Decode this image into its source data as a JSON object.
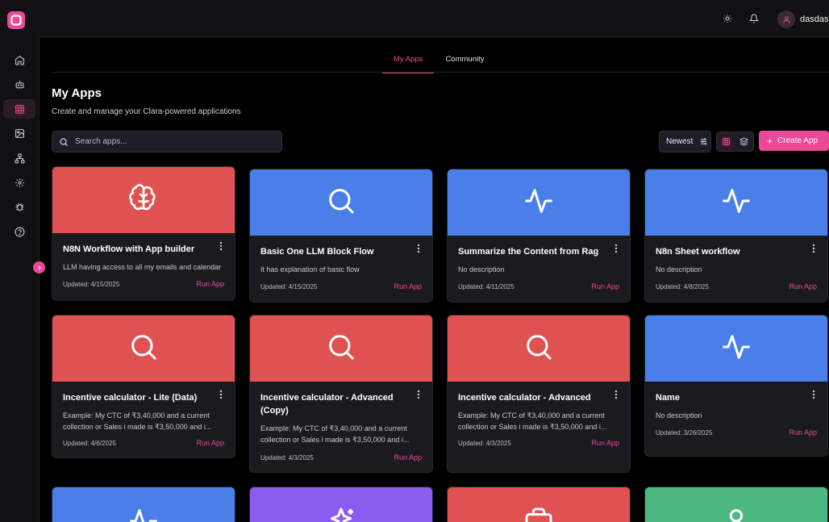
{
  "topbar": {
    "username": "dasdas"
  },
  "tabs": [
    {
      "label": "My Apps",
      "active": true
    },
    {
      "label": "Community",
      "active": false
    }
  ],
  "header": {
    "title": "My Apps",
    "subtitle": "Create and manage your Clara-powered applications"
  },
  "search": {
    "placeholder": "Search apps...",
    "value": ""
  },
  "toolbar": {
    "sort_label": "Newest",
    "create_label": "Create App"
  },
  "colors": {
    "accent": "#ec4899",
    "red": "#e05252",
    "blue": "#4a7ee8",
    "purple": "#8a5cf0",
    "green": "#4cb882"
  },
  "apps": [
    {
      "title": "N8N Workflow with App builder",
      "description": "LLM having access to all my emails and calendar",
      "updated": "Updated: 4/15/2025",
      "run_label": "Run App",
      "icon": "brain-icon",
      "color": "red"
    },
    {
      "title": "Basic One LLM Block Flow",
      "description": "It has explanation of basic flow",
      "updated": "Updated: 4/15/2025",
      "run_label": "Run App",
      "icon": "search-icon",
      "color": "blue"
    },
    {
      "title": "Summarize the Content from Rag",
      "description": "No description",
      "updated": "Updated: 4/11/2025",
      "run_label": "Run App",
      "icon": "activity-icon",
      "color": "blue"
    },
    {
      "title": "N8n Sheet workflow",
      "description": "No description",
      "updated": "Updated: 4/8/2025",
      "run_label": "Run App",
      "icon": "activity-icon",
      "color": "blue"
    },
    {
      "title": "Incentive calculator - Lite (Data)",
      "description": "Example: My CTC of ₹3,40,000 and a current collection or Sales i made is ₹3,50,000 and i...",
      "updated": "Updated: 4/6/2025",
      "run_label": "Run App",
      "icon": "search-icon",
      "color": "red"
    },
    {
      "title": "Incentive calculator - Advanced (Copy)",
      "description": "Example: My CTC of ₹3,40,000 and a current collection or Sales i made is ₹3,50,000 and i...",
      "updated": "Updated: 4/3/2025",
      "run_label": "Run App",
      "icon": "search-icon",
      "color": "red"
    },
    {
      "title": "Incentive calculator - Advanced",
      "description": "Example: My CTC of ₹3,40,000 and a current collection or Sales i made is ₹3,50,000 and i...",
      "updated": "Updated: 4/3/2025",
      "run_label": "Run App",
      "icon": "search-icon",
      "color": "red"
    },
    {
      "title": "Name",
      "description": "No description",
      "updated": "Updated: 3/26/2025",
      "run_label": "Run App",
      "icon": "activity-icon",
      "color": "blue"
    },
    {
      "icon": "activity-icon",
      "color": "blue"
    },
    {
      "icon": "sparkles-icon",
      "color": "purple"
    },
    {
      "icon": "briefcase-icon",
      "color": "red"
    },
    {
      "icon": "user-icon",
      "color": "green"
    }
  ]
}
